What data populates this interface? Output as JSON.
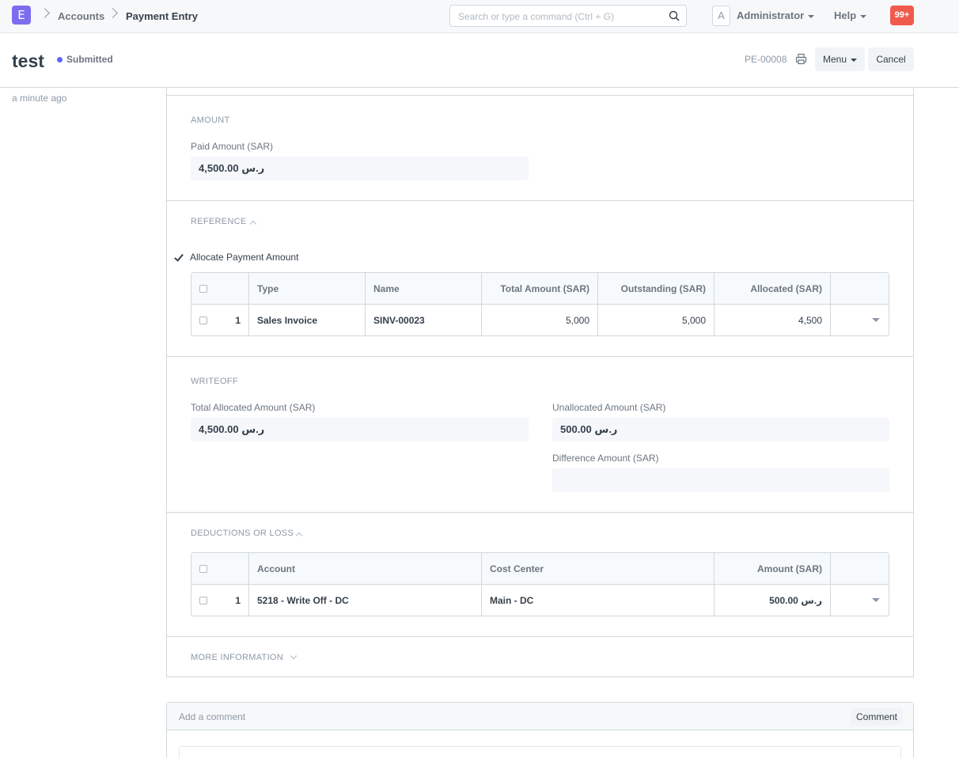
{
  "navbar": {
    "logo_letter": "E",
    "breadcrumbs": [
      "Accounts",
      "Payment Entry"
    ],
    "search_placeholder": "Search or type a command (Ctrl + G)",
    "avatar_letter": "A",
    "user_label": "Administrator",
    "help_label": "Help",
    "notification_count": "99+"
  },
  "page_head": {
    "title": "test",
    "status": "Submitted",
    "status_color": "#5e64ff",
    "doc_name": "PE-00008",
    "menu_label": "Menu",
    "cancel_label": "Cancel"
  },
  "sidebar": {
    "timestamp": "a minute ago"
  },
  "amount_section": {
    "heading": "AMOUNT",
    "paid_amount_label": "Paid Amount (SAR)",
    "paid_amount_value": "ر.س 4,500.00"
  },
  "reference_section": {
    "heading": "REFERENCE",
    "allocate_label": "Allocate Payment Amount",
    "allocate_checked": true,
    "columns": [
      "Type",
      "Name",
      "Total Amount (SAR)",
      "Outstanding (SAR)",
      "Allocated (SAR)"
    ],
    "rows": [
      {
        "idx": "1",
        "type": "Sales Invoice",
        "name": "SINV-00023",
        "total": "5,000",
        "outstanding": "5,000",
        "allocated": "4,500"
      }
    ]
  },
  "writeoff_section": {
    "heading": "WRITEOFF",
    "total_allocated_label": "Total Allocated Amount (SAR)",
    "total_allocated_value": "ر.س 4,500.00",
    "unallocated_label": "Unallocated Amount (SAR)",
    "unallocated_value": "ر.س 500.00",
    "difference_label": "Difference Amount (SAR)",
    "difference_value": ""
  },
  "deductions_section": {
    "heading": "DEDUCTIONS OR LOSS",
    "columns": [
      "Account",
      "Cost Center",
      "Amount (SAR)"
    ],
    "rows": [
      {
        "idx": "1",
        "account": "5218 - Write Off - DC",
        "cost_center": "Main - DC",
        "amount": "ر.س 500.00"
      }
    ]
  },
  "more_info_section": {
    "heading": "MORE INFORMATION"
  },
  "comment": {
    "placeholder": "Add a comment",
    "button_label": "Comment"
  }
}
